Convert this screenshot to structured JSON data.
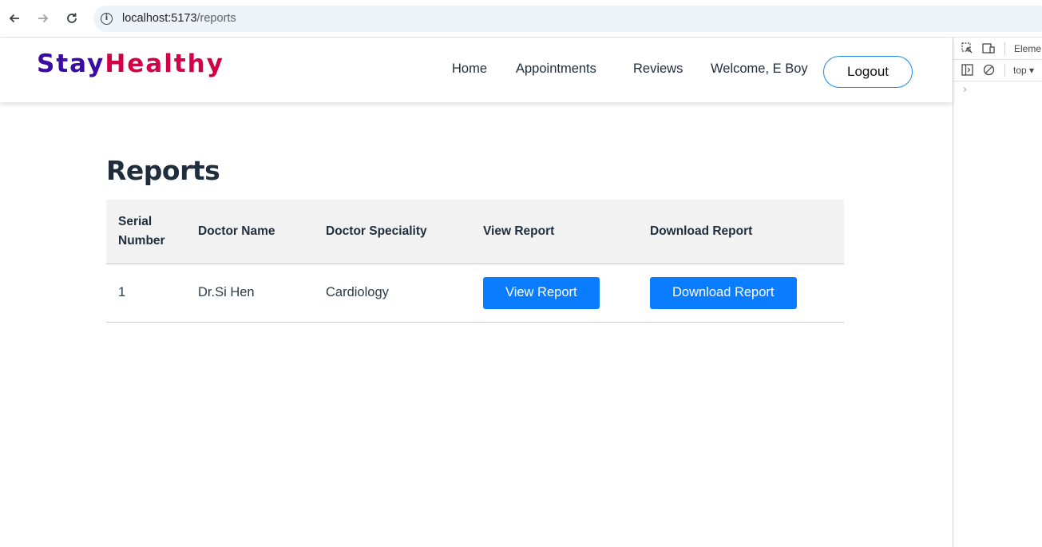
{
  "browser": {
    "url_host": "localhost:5173",
    "url_path": "/reports",
    "back_icon": "arrow-left-icon",
    "forward_icon": "arrow-right-icon",
    "reload_icon": "reload-icon",
    "info_icon": "info-icon"
  },
  "devtools": {
    "tab_label": "Eleme",
    "context_label": "top",
    "context_caret": "▾",
    "console_prompt": "›"
  },
  "header": {
    "brand_part1": "Stay",
    "brand_part2": "Healthy",
    "brand_color1": "#3a0ca3",
    "brand_color2": "#d40046",
    "nav": {
      "home": "Home",
      "appointments": "Appointments",
      "reviews": "Reviews",
      "welcome": "Welcome, E Boy"
    },
    "logout_label": "Logout"
  },
  "main": {
    "title": "Reports",
    "table": {
      "headers": [
        "Serial\nNumber",
        "Doctor Name",
        "Doctor Speciality",
        "View Report",
        "Download Report"
      ],
      "rows": [
        {
          "serial": "1",
          "doctor_name": "Dr.Si Hen",
          "speciality": "Cardiology",
          "view_label": "View Report",
          "download_label": "Download Report"
        }
      ]
    }
  },
  "colors": {
    "accent": "#0a7cff",
    "logout_border": "#1e88e5",
    "text_dark": "#1f2d3d"
  }
}
